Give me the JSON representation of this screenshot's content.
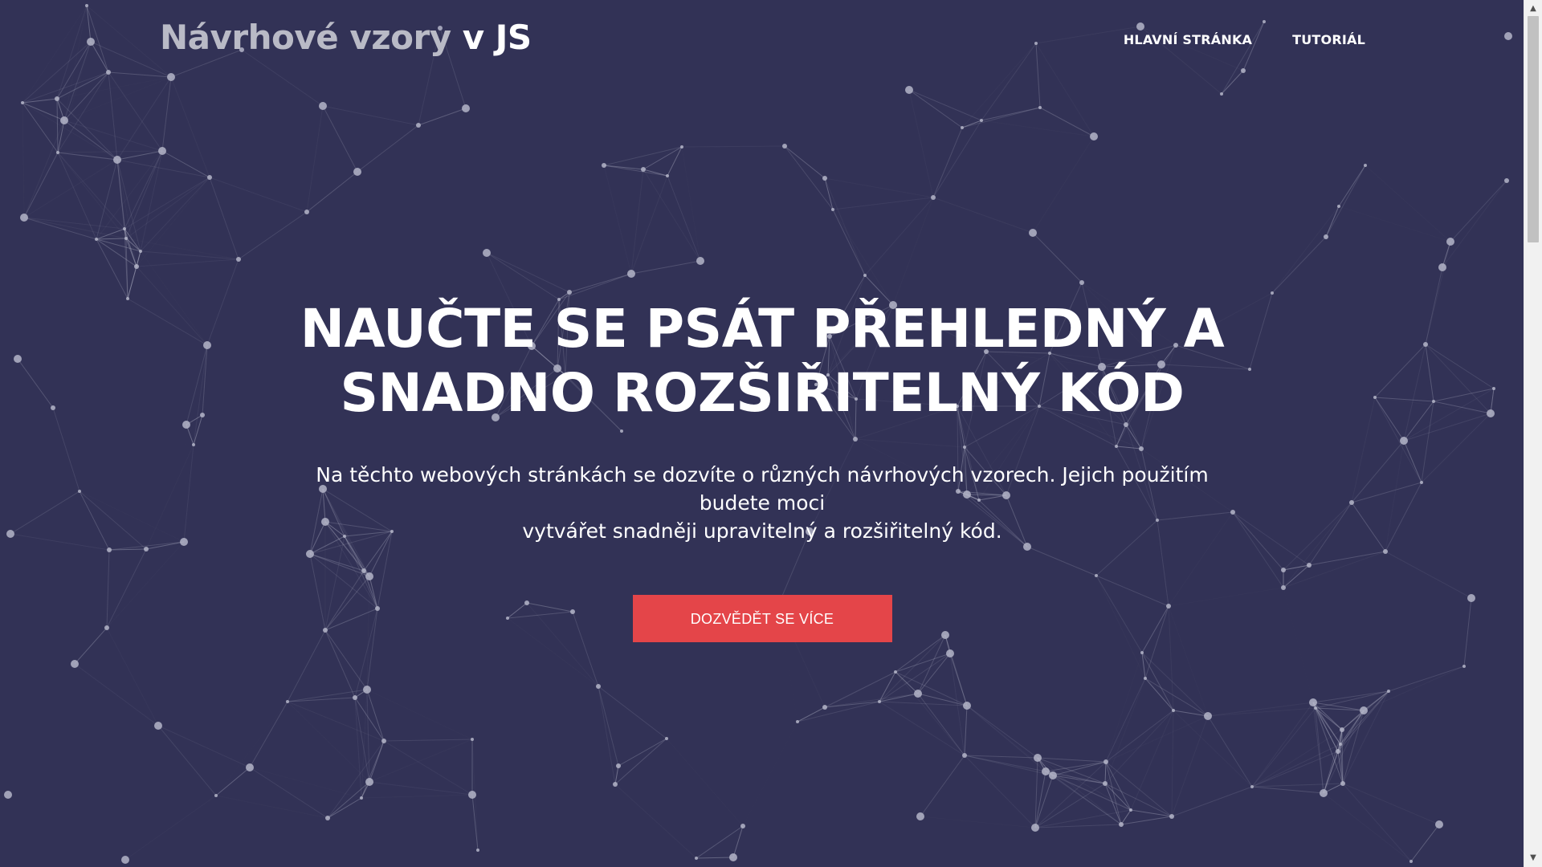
{
  "header": {
    "brand_light": "Návrhové vzory",
    "brand_strong": "v JS",
    "nav": [
      {
        "label": "HLAVNÍ STRÁNKA"
      },
      {
        "label": "TUTORIÁL"
      }
    ]
  },
  "hero": {
    "title_line1": "NAUČTE SE PSÁT PŘEHLEDNÝ A",
    "title_line2": "SNADNO ROZŠIŘITELNÝ KÓD",
    "text_line1": "Na těchto webových stránkách se dozvíte o různých návrhových vzorech. Jejich použitím budete moci",
    "text_line2": "vytvářet snadněji upravitelný a rozšiřitelný kód.",
    "cta_label": "DOZVĚDĚT SE VÍCE"
  },
  "theme": {
    "background": "#323256",
    "accent": "#e44549",
    "particle_color": "#b4b5c8"
  },
  "icons": {
    "scroll_up": "▲",
    "scroll_down": "▼"
  }
}
